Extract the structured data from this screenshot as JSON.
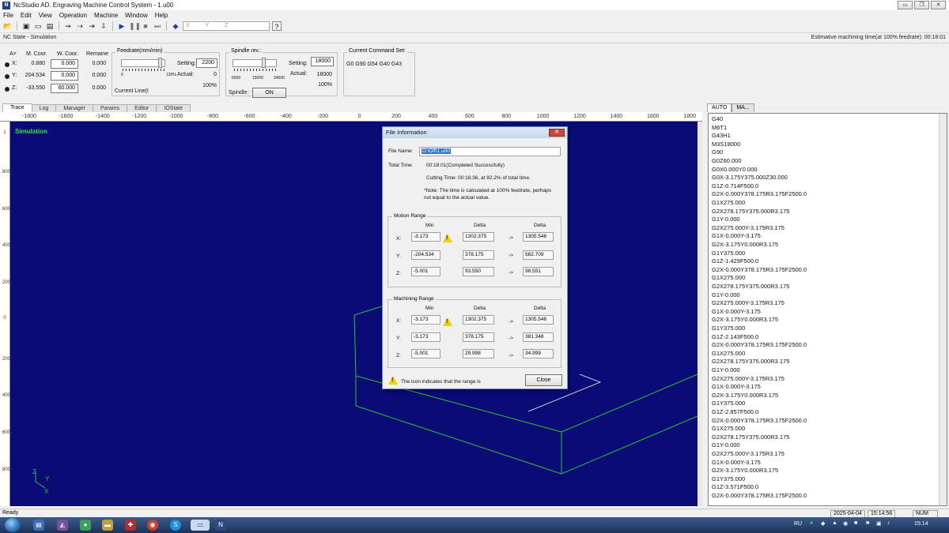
{
  "window": {
    "title": "NcStudio AD. Engraving Machine Control System - 1.u00",
    "buttons": [
      "▭",
      "❐",
      "✕"
    ]
  },
  "menu": [
    "File",
    "Edit",
    "View",
    "Operation",
    "Machine",
    "Window",
    "Help"
  ],
  "toolbar": {
    "axis_field": "X  Y  Z"
  },
  "state_strip": {
    "left": "NC State - Simulation",
    "right": "Estimative machining time(at 100% feedrate): 00:18:01"
  },
  "coords": {
    "headers": {
      "axis": "A>",
      "machine": "M. Coor.",
      "work": "W. Coor.",
      "remain": "Remaine"
    },
    "rows": [
      {
        "axis": "X:",
        "machine": "0.880",
        "work": "0.000",
        "remain": "0.000"
      },
      {
        "axis": "Y:",
        "machine": "204.534",
        "work": "0.000",
        "remain": "0.000"
      },
      {
        "axis": "Z:",
        "machine": "-33.550",
        "work": "60.000",
        "remain": "0.000"
      }
    ]
  },
  "feedrate": {
    "title": "Feedrate(mm/min)",
    "min": "0",
    "max": "120%",
    "setting_label": "Setting:",
    "setting": "2200",
    "actual_label": "Actual:",
    "actual": "0",
    "percent": "100%",
    "current_line": "Current Line(I"
  },
  "spindle": {
    "title": "Spindle rev.:",
    "ticks": [
      "6000",
      "15000",
      "24000"
    ],
    "setting_label": "Setting:",
    "setting": "18000",
    "actual_label": "Actual:",
    "actual": "18000",
    "percent": "100%",
    "state_label": "Spindle:",
    "state": "ON"
  },
  "command_set": {
    "title": "Current Command Set:",
    "value": "G0 G90 G54 G40 G43"
  },
  "tabs": [
    "Trace",
    "Log",
    "Manager",
    "Params",
    "Editor",
    "IOState"
  ],
  "ruler_x": [
    "-1800",
    "-1600",
    "-1400",
    "-1200",
    "-1000",
    "-800",
    "-600",
    "-400",
    "-200",
    "0",
    "200",
    "400",
    "600",
    "800",
    "1000",
    "1200",
    "1400",
    "1600",
    "1800"
  ],
  "ruler_y": [
    {
      "v": "1",
      "t": 165
    },
    {
      "v": "800",
      "t": 215
    },
    {
      "v": "600",
      "t": 262
    },
    {
      "v": "400",
      "t": 308
    },
    {
      "v": "200",
      "t": 355
    },
    {
      "v": "0",
      "t": 400
    },
    {
      "v": "200",
      "t": 452
    },
    {
      "v": "400",
      "t": 498
    },
    {
      "v": "600",
      "t": 545
    },
    {
      "v": "800",
      "t": 592
    }
  ],
  "canvas": {
    "label": "Simulation",
    "axis_y": "Y",
    "axis_x": "X",
    "axis_z": "Z"
  },
  "dialog": {
    "title": "File Information",
    "file_name_label": "File Name:",
    "file_name": "D:\\Off\\1.u00",
    "total_time_label": "Total Time:",
    "total_time": "00:18:01(Completed Successfully)",
    "cutting_time": "Cutting Time: 00:16:36, at 92.2% of total time.",
    "note_line1": "*Note: The time is calculated at 100% feedrate, perhaps",
    "note_line2": "not equal to the actual value.",
    "motion_range": {
      "title": "Motion Range",
      "col_min": "Min",
      "col_delta": "Delta",
      "col_max": "Delta",
      "rows": [
        {
          "axis": "X:",
          "min": "-3.173",
          "delta": "1302.375",
          "arrow": "->",
          "max": "1305.548",
          "warn": true
        },
        {
          "axis": "Y:",
          "min": "-204.534",
          "delta": "378.175",
          "arrow": "->",
          "max": "582.709",
          "warn": false
        },
        {
          "axis": "Z:",
          "min": "-5.001",
          "delta": "93.550",
          "arrow": "->",
          "max": "98.551",
          "warn": false
        }
      ]
    },
    "machining_range": {
      "title": "Machining Range",
      "col_min": "Min",
      "col_delta": "Delta",
      "col_max": "Delta",
      "rows": [
        {
          "axis": "X:",
          "min": "-3.173",
          "delta": "1302.375",
          "arrow": "->",
          "max": "1305.548",
          "warn": true
        },
        {
          "axis": "Y:",
          "min": "-3.173",
          "delta": "378.175",
          "arrow": "->",
          "max": "381.348",
          "warn": false
        },
        {
          "axis": "Z:",
          "min": "-5.001",
          "delta": "29.998",
          "arrow": "->",
          "max": "34.999",
          "warn": false
        }
      ]
    },
    "footer_note": "The icon indicates that the range is",
    "close_label": "Close"
  },
  "right_panel": {
    "tabs": [
      "AUTO",
      "MA..."
    ],
    "code": [
      "G40",
      "M6T1",
      "G43H1",
      "M3S18000",
      "G90",
      "G0Z60.000",
      "G0X0.000Y0.000",
      "G0X-3.175Y375.000Z30.000",
      "G1Z-0.714F500.0",
      "G2X-0.000Y378.175R3.175F2500.0",
      "G1X275.000",
      "G2X278.175Y375.000R3.175",
      "G1Y-0.000",
      "G2X275.000Y-3.175R3.175",
      "G1X-0.000Y-3.175",
      "G2X-3.175Y0.000R3.175",
      "G1Y375.000",
      "G1Z-1.429F500.0",
      "G2X-0.000Y378.175R3.175F2500.0",
      "G1X275.000",
      "G2X278.175Y375.000R3.175",
      "G1Y-0.000",
      "G2X275.000Y-3.175R3.175",
      "G1X-0.000Y-3.175",
      "G2X-3.175Y0.000R3.175",
      "G1Y375.000",
      "G1Z-2.143F500.0",
      "G2X-0.000Y378.175R3.175F2500.0",
      "G1X275.000",
      "G2X278.175Y375.000R3.175",
      "G1Y-0.000",
      "G2X275.000Y-3.175R3.175",
      "G1X-0.000Y-3.175",
      "G2X-3.175Y0.000R3.175",
      "G1Y375.000",
      "G1Z-2.857F500.0",
      "G2X-0.000Y378.175R3.175F2500.0",
      "G1X275.000",
      "G2X278.175Y375.000R3.175",
      "G1Y-0.000",
      "G2X275.000Y-3.175R3.175",
      "G1X-0.000Y-3.175",
      "G2X-3.175Y0.000R3.175",
      "G1Y375.000",
      "G1Z-3.571F500.0",
      "G2X-0.000Y378.175R3.175F2500.0"
    ]
  },
  "status_bar": {
    "left": "Ready",
    "date": "2025-04-04",
    "time": "15:14:56",
    "num": "NUM"
  },
  "taskbar": {
    "lang": "RU",
    "clock": "15:14"
  },
  "colors": {
    "canvas_bg": "#0b0b78",
    "wireframe": "#22c822",
    "label_green": "#22ee22"
  }
}
